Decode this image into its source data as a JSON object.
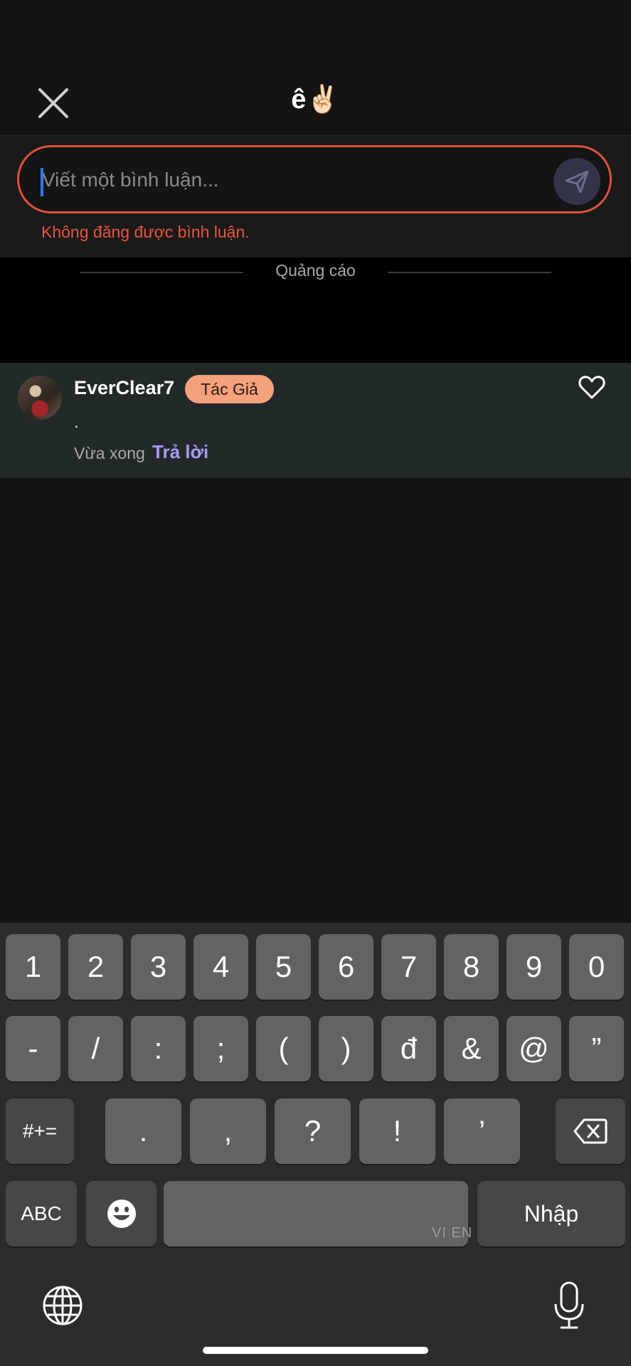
{
  "header": {
    "title": "ê✌🏻"
  },
  "comment_box": {
    "placeholder": "Viết một bình luận...",
    "value": "",
    "error": "Không đăng được bình luận."
  },
  "ad": {
    "label": "Quảng cáo"
  },
  "comment": {
    "username": "EverClear7",
    "badge": "Tác Giả",
    "text": ".",
    "time": "Vừa xong",
    "reply_label": "Trả lời"
  },
  "keyboard": {
    "row1": [
      "1",
      "2",
      "3",
      "4",
      "5",
      "6",
      "7",
      "8",
      "9",
      "0"
    ],
    "row2": [
      "-",
      "/",
      ":",
      ";",
      "(",
      ")",
      "đ",
      "&",
      "@",
      "”"
    ],
    "row3": [
      ".",
      ",",
      "?",
      "!",
      "’"
    ],
    "symbols_key": "#+=",
    "abc_key": "ABC",
    "return_key": "Nhập",
    "space_lang": "VI EN"
  },
  "colors": {
    "accent_error": "#e1513d",
    "badge_bg": "#f4a17c",
    "reply_link": "#a89cf2",
    "cursor": "#2f7cf6"
  },
  "icons": [
    "close-icon",
    "send-icon",
    "heart-icon",
    "backspace-icon",
    "emoji-icon",
    "globe-icon",
    "microphone-icon"
  ]
}
